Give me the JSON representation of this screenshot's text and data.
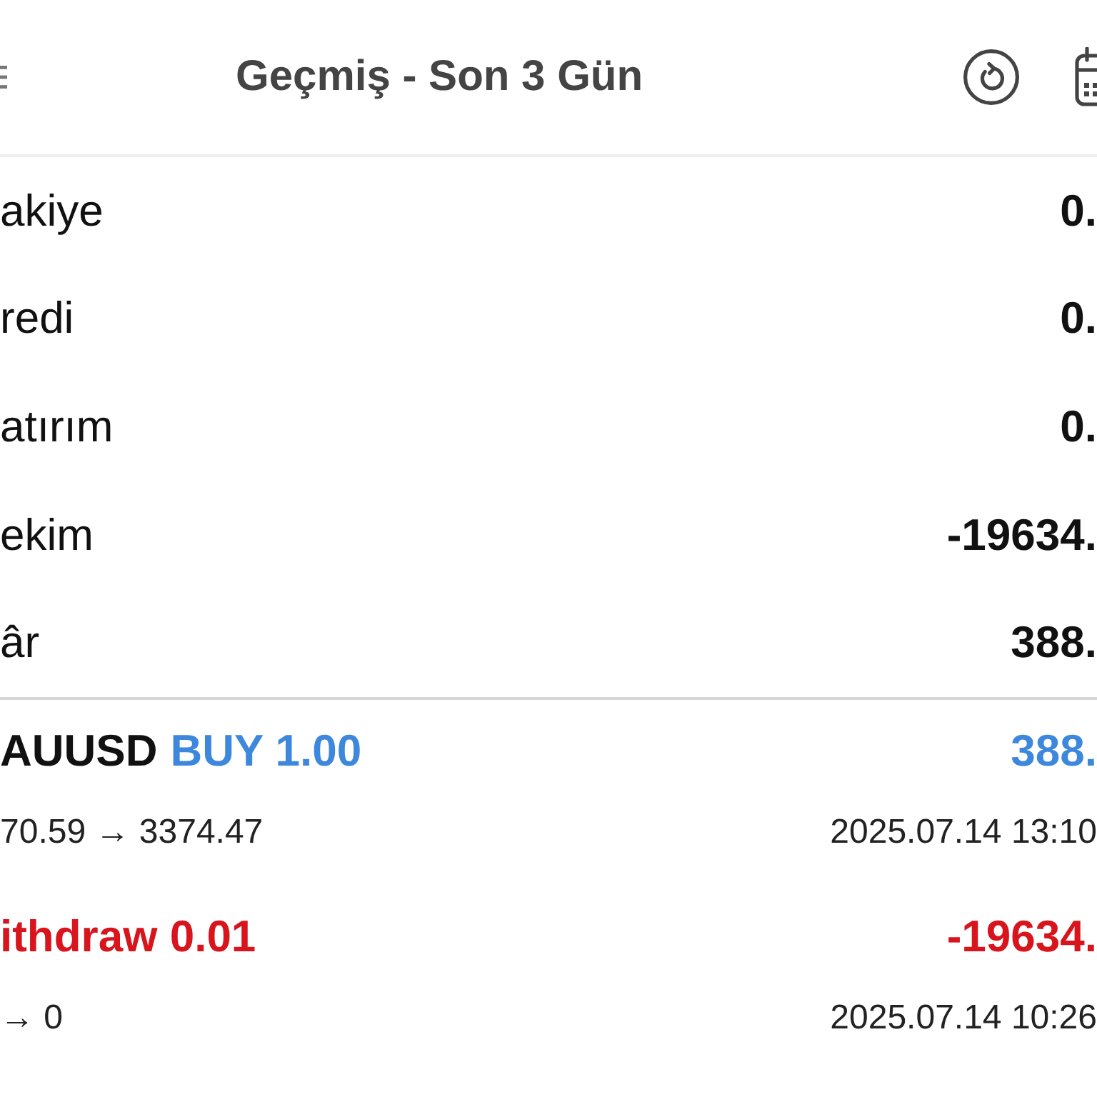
{
  "header": {
    "title": "Geçmiş - Son 3 Gün"
  },
  "summary": [
    {
      "label": "akiye",
      "value": "0."
    },
    {
      "label": "redi",
      "value": "0."
    },
    {
      "label": "atırım",
      "value": "0."
    },
    {
      "label": "ekim",
      "value": "-19634."
    },
    {
      "label": "âr",
      "value": "388."
    }
  ],
  "deals": [
    {
      "kind": "trade",
      "symbol": "AUUSD",
      "action": "BUY 1.00",
      "color": "#3d88dc",
      "profit": "388.",
      "prices": "70.59 → 3374.47",
      "time": "2025.07.14 13:10"
    },
    {
      "kind": "balance",
      "action": "ithdraw 0.01",
      "color": "#d8141c",
      "profit": "-19634.",
      "prices": "→ 0",
      "time": "2025.07.14 10:26"
    }
  ]
}
